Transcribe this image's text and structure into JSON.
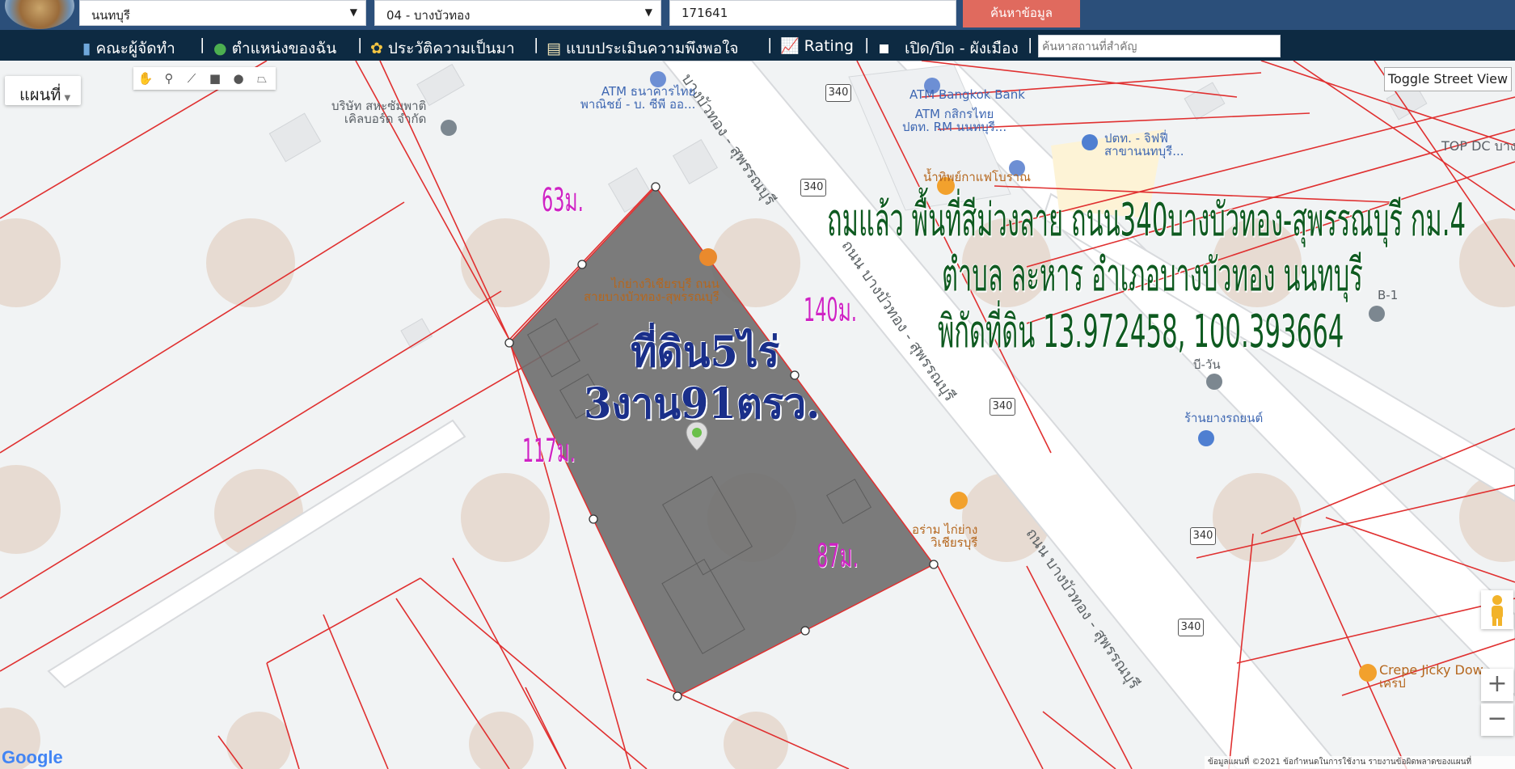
{
  "header": {
    "province": "นนทบุรี",
    "district": "04 - บางบัวทอง",
    "parcel_no": "171641",
    "search_button": "ค้นหาข้อมูล"
  },
  "menu": {
    "items": [
      {
        "label": "คณะผู้จัดทำ",
        "icon": "team-icon"
      },
      {
        "label": "ตำแหน่งของฉัน",
        "icon": "globe-icon"
      },
      {
        "label": "ประวัติความเป็นมา",
        "icon": "sprout-icon"
      },
      {
        "label": "แบบประเมินความพึงพอใจ",
        "icon": "survey-icon"
      },
      {
        "label": "Rating",
        "icon": "chart-icon"
      },
      {
        "label": "เปิด/ปิด - ผังเมือง",
        "icon": "checkbox-icon"
      }
    ],
    "place_search_placeholder": "ค้นหาสถานที่สำคัญ"
  },
  "map": {
    "map_type": "แผนที่",
    "street_view_button": "Toggle Street View",
    "zoom_in": "+",
    "zoom_out": "−",
    "google": "Google",
    "attribution": "ข้อมูลแผนที่ ©2021   ข้อกำหนดในการใช้งาน   รายงานข้อผิดพลาดของแผนที่",
    "route_shields": [
      "340",
      "340",
      "340",
      "340",
      "340"
    ],
    "road_name": "ถนน บางบัวทอง - สุพรรณบุรี",
    "road_name_short": "บางบัวทอง - สุพรรณบุรี",
    "pois": [
      {
        "line1": "ATM ธนาคารไทย",
        "line2": "พาณิชย์ - บ. ซีพี ออ..."
      },
      {
        "line1": "บริษัท สหะซัมพาติ",
        "line2": "เคิลบอร์ด จำกัด"
      },
      {
        "line1": "ATM Bangkok Bank",
        "line2": ""
      },
      {
        "line1": "ATM กสิกรไทย",
        "line2": "ปตท. RM นนทบุรี..."
      },
      {
        "line1": "ปตท. - จิฟฟี่",
        "line2": "สาขานนทบุรี..."
      },
      {
        "line1": "TOP DC บาง",
        "line2": ""
      },
      {
        "line1": "น้ำทิพย์กาแฟโบราณ",
        "line2": ""
      },
      {
        "line1": "ไก่ย่างวิเชียรบุรี ถนน",
        "line2": "สายบางบัวทอง-สุพรรณบุรี"
      },
      {
        "line1": "B-1",
        "line2": ""
      },
      {
        "line1": "บี-วัน",
        "line2": ""
      },
      {
        "line1": "ร้านยางรถยนต์",
        "line2": ""
      },
      {
        "line1": "อร่าม ไก่ย่าง",
        "line2": "วิเชียรบุรี"
      },
      {
        "line1": "Crepe Jicky Dow",
        "line2": "เครป"
      }
    ]
  },
  "annotations": {
    "headline_line1": "ถมแล้ว พื้นที่สีม่วงลาย ถนน340บางบัวทอง-สุพรรณบุรี กม.4",
    "headline_line2": "ตำบล ละหาร อำเภอบางบัวทอง นนทบุรี",
    "headline_line3": "พิกัดที่ดิน 13.972458, 100.393664",
    "area_line1": "ที่ดิน5ไร่",
    "area_line2": "3งาน91ตรว.",
    "dim_top": "63ม.",
    "dim_right": "140ม.",
    "dim_left": "117ม.",
    "dim_bottom": "87ม."
  },
  "colors": {
    "header_bg": "#2b4f7a",
    "menu_bg": "#0d2a42",
    "search_button": "#e06a5e",
    "parcel_line": "#e03030",
    "plot_fill": "#6e6e6e",
    "dim_text": "#cf23c4",
    "headline_text": "#0e5a20",
    "area_text": "#1a2f8a"
  }
}
